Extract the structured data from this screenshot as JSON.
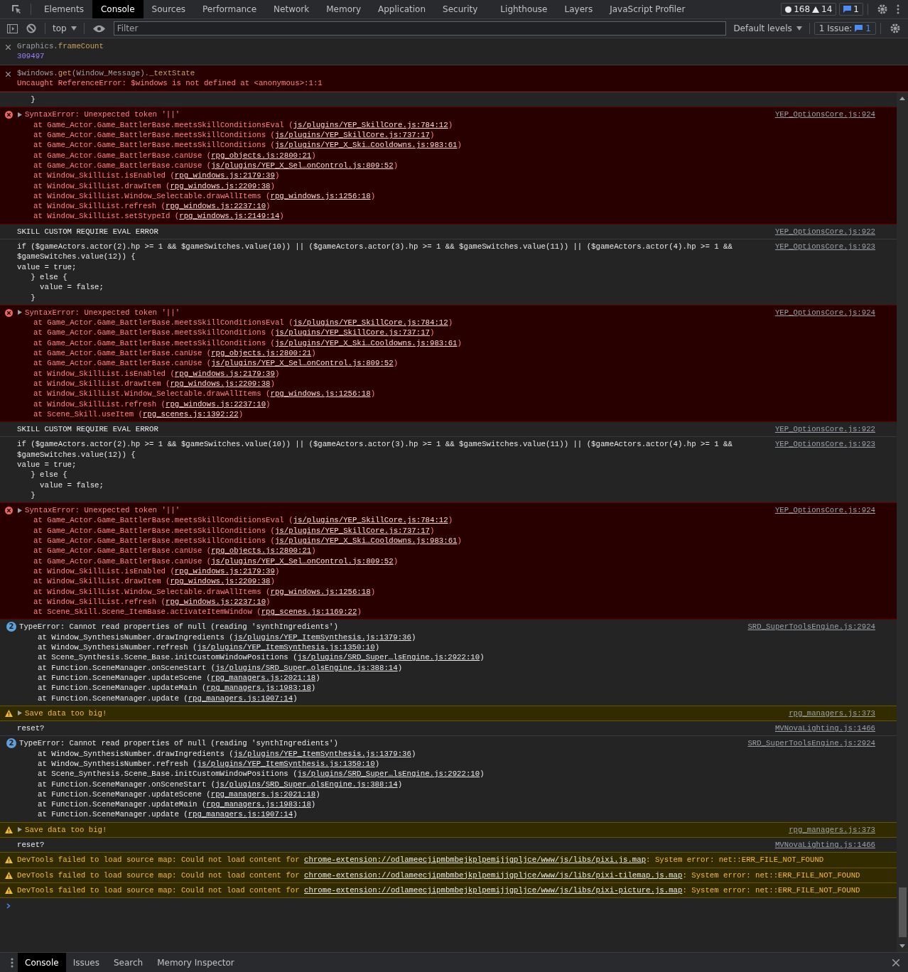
{
  "main_tabs": [
    {
      "label": "Elements",
      "selected": false
    },
    {
      "label": "Console",
      "selected": true
    },
    {
      "label": "Sources",
      "selected": false
    },
    {
      "label": "Performance",
      "selected": false
    },
    {
      "label": "Network",
      "selected": false
    },
    {
      "label": "Memory",
      "selected": false
    },
    {
      "label": "Application",
      "selected": false
    },
    {
      "label": "Security",
      "selected": false
    },
    {
      "label": "Lighthouse",
      "selected": false
    },
    {
      "label": "Layers",
      "selected": false
    },
    {
      "label": "JavaScript Profiler",
      "selected": false
    }
  ],
  "counters": {
    "errors": "168",
    "warnings": "14",
    "messages": "1"
  },
  "toolbar": {
    "context": "top",
    "filter_placeholder": "Filter",
    "levels": "Default levels",
    "issues_label": "1 Issue:",
    "issues_count": "1"
  },
  "pinned": [
    {
      "segments": [
        {
          "text": "Graphics.",
          "kind": "plain"
        },
        {
          "text": "frameCount",
          "kind": "prop"
        }
      ],
      "result": "309497",
      "failed": false
    },
    {
      "segments": [
        {
          "text": "$windows.",
          "kind": "plain"
        },
        {
          "text": "get",
          "kind": "prop"
        },
        {
          "text": "(Window_Message).",
          "kind": "plain"
        },
        {
          "text": "_textState",
          "kind": "prop"
        }
      ],
      "result": "Uncaught ReferenceError: $windows is not defined at <anonymous>:1:1",
      "failed": true
    }
  ],
  "messages": [
    {
      "kind": "log",
      "lines": [
        "   }"
      ]
    },
    {
      "kind": "error",
      "expanded": false,
      "text": "SyntaxError: Unexpected token '||'",
      "source": "YEP_OptionsCore.js:924",
      "frames": [
        {
          "call": "at Game_Actor.Game_BattlerBase.meetsSkillConditionsEval (",
          "link": "js/plugins/YEP_SkillCore.js:784:12",
          "end": ")"
        },
        {
          "call": "at Game_Actor.Game_BattlerBase.meetsSkillConditions (",
          "link": "js/plugins/YEP_SkillCore.js:737:17",
          "end": ")"
        },
        {
          "call": "at Game_Actor.Game_BattlerBase.meetsSkillConditions (",
          "link": "js/plugins/YEP_X_Ski…Cooldowns.js:983:61",
          "end": ")"
        },
        {
          "call": "at Game_Actor.Game_BattlerBase.canUse (",
          "link": "rpg_objects.js:2800:21",
          "end": ")"
        },
        {
          "call": "at Game_Actor.Game_BattlerBase.canUse (",
          "link": "js/plugins/YEP_X_Sel…onControl.js:809:52",
          "end": ")"
        },
        {
          "call": "at Window_SkillList.isEnabled (",
          "link": "rpg_windows.js:2179:39",
          "end": ")"
        },
        {
          "call": "at Window_SkillList.drawItem (",
          "link": "rpg_windows.js:2209:38",
          "end": ")"
        },
        {
          "call": "at Window_SkillList.Window_Selectable.drawAllItems (",
          "link": "rpg_windows.js:1256:18",
          "end": ")"
        },
        {
          "call": "at Window_SkillList.refresh (",
          "link": "rpg_windows.js:2237:10",
          "end": ")"
        },
        {
          "call": "at Window_SkillList.setStypeId (",
          "link": "rpg_windows.js:2149:14",
          "end": ")"
        }
      ]
    },
    {
      "kind": "log",
      "lines": [
        "SKILL CUSTOM REQUIRE EVAL ERROR"
      ],
      "source": "YEP_OptionsCore.js:922"
    },
    {
      "kind": "log",
      "lines": [
        "if ($gameActors.actor(2).hp >= 1 && $gameSwitches.value(10)) || ($gameActors.actor(3).hp >= 1 && $gameSwitches.value(11)) || ($gameActors.actor(4).hp >= 1 &&",
        "$gameSwitches.value(12)) {",
        "value = true;",
        "   } else {",
        "     value = false;",
        "   }"
      ],
      "source": "YEP_OptionsCore.js:923"
    },
    {
      "kind": "error",
      "expanded": false,
      "text": "SyntaxError: Unexpected token '||'",
      "source": "YEP_OptionsCore.js:924",
      "frames": [
        {
          "call": "at Game_Actor.Game_BattlerBase.meetsSkillConditionsEval (",
          "link": "js/plugins/YEP_SkillCore.js:784:12",
          "end": ")"
        },
        {
          "call": "at Game_Actor.Game_BattlerBase.meetsSkillConditions (",
          "link": "js/plugins/YEP_SkillCore.js:737:17",
          "end": ")"
        },
        {
          "call": "at Game_Actor.Game_BattlerBase.meetsSkillConditions (",
          "link": "js/plugins/YEP_X_Ski…Cooldowns.js:983:61",
          "end": ")"
        },
        {
          "call": "at Game_Actor.Game_BattlerBase.canUse (",
          "link": "rpg_objects.js:2800:21",
          "end": ")"
        },
        {
          "call": "at Game_Actor.Game_BattlerBase.canUse (",
          "link": "js/plugins/YEP_X_Sel…onControl.js:809:52",
          "end": ")"
        },
        {
          "call": "at Window_SkillList.isEnabled (",
          "link": "rpg_windows.js:2179:39",
          "end": ")"
        },
        {
          "call": "at Window_SkillList.drawItem (",
          "link": "rpg_windows.js:2209:38",
          "end": ")"
        },
        {
          "call": "at Window_SkillList.Window_Selectable.drawAllItems (",
          "link": "rpg_windows.js:1256:18",
          "end": ")"
        },
        {
          "call": "at Window_SkillList.refresh (",
          "link": "rpg_windows.js:2237:10",
          "end": ")"
        },
        {
          "call": "at Scene_Skill.useItem (",
          "link": "rpg_scenes.js:1392:22",
          "end": ")"
        }
      ]
    },
    {
      "kind": "log",
      "lines": [
        "SKILL CUSTOM REQUIRE EVAL ERROR"
      ],
      "source": "YEP_OptionsCore.js:922"
    },
    {
      "kind": "log",
      "lines": [
        "if ($gameActors.actor(2).hp >= 1 && $gameSwitches.value(10)) || ($gameActors.actor(3).hp >= 1 && $gameSwitches.value(11)) || ($gameActors.actor(4).hp >= 1 &&",
        "$gameSwitches.value(12)) {",
        "value = true;",
        "   } else {",
        "     value = false;",
        "   }"
      ],
      "source": "YEP_OptionsCore.js:923"
    },
    {
      "kind": "error",
      "expanded": false,
      "text": "SyntaxError: Unexpected token '||'",
      "source": "YEP_OptionsCore.js:924",
      "frames": [
        {
          "call": "at Game_Actor.Game_BattlerBase.meetsSkillConditionsEval (",
          "link": "js/plugins/YEP_SkillCore.js:784:12",
          "end": ")"
        },
        {
          "call": "at Game_Actor.Game_BattlerBase.meetsSkillConditions (",
          "link": "js/plugins/YEP_SkillCore.js:737:17",
          "end": ")"
        },
        {
          "call": "at Game_Actor.Game_BattlerBase.meetsSkillConditions (",
          "link": "js/plugins/YEP_X_Ski…Cooldowns.js:983:61",
          "end": ")"
        },
        {
          "call": "at Game_Actor.Game_BattlerBase.canUse (",
          "link": "rpg_objects.js:2800:21",
          "end": ")"
        },
        {
          "call": "at Game_Actor.Game_BattlerBase.canUse (",
          "link": "js/plugins/YEP_X_Sel…onControl.js:809:52",
          "end": ")"
        },
        {
          "call": "at Window_SkillList.isEnabled (",
          "link": "rpg_windows.js:2179:39",
          "end": ")"
        },
        {
          "call": "at Window_SkillList.drawItem (",
          "link": "rpg_windows.js:2209:38",
          "end": ")"
        },
        {
          "call": "at Window_SkillList.Window_Selectable.drawAllItems (",
          "link": "rpg_windows.js:1256:18",
          "end": ")"
        },
        {
          "call": "at Window_SkillList.refresh (",
          "link": "rpg_windows.js:2237:10",
          "end": ")"
        },
        {
          "call": "at Scene_Skill.Scene_ItemBase.activateItemWindow (",
          "link": "rpg_scenes.js:1169:22",
          "end": ")"
        }
      ]
    },
    {
      "kind": "grouped",
      "count": "2",
      "text": "TypeError: Cannot read properties of null (reading 'synthIngredients')",
      "source": "SRD_SuperToolsEngine.js:2924",
      "frames": [
        {
          "call": "at Window_SynthesisNumber.drawIngredients (",
          "link": "js/plugins/YEP_ItemSynthesis.js:1379:36",
          "end": ")"
        },
        {
          "call": "at Window_SynthesisNumber.refresh (",
          "link": "js/plugins/YEP_ItemSynthesis.js:1350:10",
          "end": ")"
        },
        {
          "call": "at Scene_Synthesis.Scene_Base.initCustomWindowPositions (",
          "link": "js/plugins/SRD_Super…lsEngine.js:2922:10",
          "end": ")"
        },
        {
          "call": "at Function.SceneManager.onSceneStart (",
          "link": "js/plugins/SRD_Super…olsEngine.js:388:14",
          "end": ")"
        },
        {
          "call": "at Function.SceneManager.updateScene (",
          "link": "rpg_managers.js:2021:18",
          "end": ")"
        },
        {
          "call": "at Function.SceneManager.updateMain (",
          "link": "rpg_managers.js:1983:18",
          "end": ")"
        },
        {
          "call": "at Function.SceneManager.update (",
          "link": "rpg_managers.js:1907:14",
          "end": ")"
        }
      ]
    },
    {
      "kind": "warning",
      "expanded": false,
      "text": "Save data too big!",
      "source": "rpg_managers.js:373"
    },
    {
      "kind": "log",
      "lines": [
        "reset?"
      ],
      "source": "MVNovaLighting.js:1466"
    },
    {
      "kind": "grouped",
      "count": "2",
      "text": "TypeError: Cannot read properties of null (reading 'synthIngredients')",
      "source": "SRD_SuperToolsEngine.js:2924",
      "frames": [
        {
          "call": "at Window_SynthesisNumber.drawIngredients (",
          "link": "js/plugins/YEP_ItemSynthesis.js:1379:36",
          "end": ")"
        },
        {
          "call": "at Window_SynthesisNumber.refresh (",
          "link": "js/plugins/YEP_ItemSynthesis.js:1350:10",
          "end": ")"
        },
        {
          "call": "at Scene_Synthesis.Scene_Base.initCustomWindowPositions (",
          "link": "js/plugins/SRD_Super…lsEngine.js:2922:10",
          "end": ")"
        },
        {
          "call": "at Function.SceneManager.onSceneStart (",
          "link": "js/plugins/SRD_Super…olsEngine.js:388:14",
          "end": ")"
        },
        {
          "call": "at Function.SceneManager.updateScene (",
          "link": "rpg_managers.js:2021:18",
          "end": ")"
        },
        {
          "call": "at Function.SceneManager.updateMain (",
          "link": "rpg_managers.js:1983:18",
          "end": ")"
        },
        {
          "call": "at Function.SceneManager.update (",
          "link": "rpg_managers.js:1907:14",
          "end": ")"
        }
      ]
    },
    {
      "kind": "warning",
      "expanded": false,
      "text": "Save data too big!",
      "source": "rpg_managers.js:373"
    },
    {
      "kind": "log",
      "lines": [
        "reset?"
      ],
      "source": "MVNovaLighting.js:1466"
    },
    {
      "kind": "sourcemap",
      "before": "DevTools failed to load source map: Could not load content for ",
      "link": "chrome-extension://odlameecjipmbmbejkplpemijjgpljce/www/js/libs/pixi.js.map",
      "after": ": System error: net::ERR_FILE_NOT_FOUND"
    },
    {
      "kind": "sourcemap",
      "before": "DevTools failed to load source map: Could not load content for ",
      "link": "chrome-extension://odlameecjipmbmbejkplpemijjgpljce/www/js/libs/pixi-tilemap.js.map",
      "after": ": System error: net::ERR_FILE_NOT_FOUND"
    },
    {
      "kind": "sourcemap",
      "before": "DevTools failed to load source map: Could not load content for ",
      "link": "chrome-extension://odlameecjipmbmbejkplpemijjgpljce/www/js/libs/pixi-picture.js.map",
      "after": ": System error: net::ERR_FILE_NOT_FOUND"
    }
  ],
  "drawer_tabs": [
    {
      "label": "Console",
      "selected": true
    },
    {
      "label": "Issues",
      "selected": false
    },
    {
      "label": "Search",
      "selected": false
    },
    {
      "label": "Memory Inspector",
      "selected": false
    }
  ]
}
